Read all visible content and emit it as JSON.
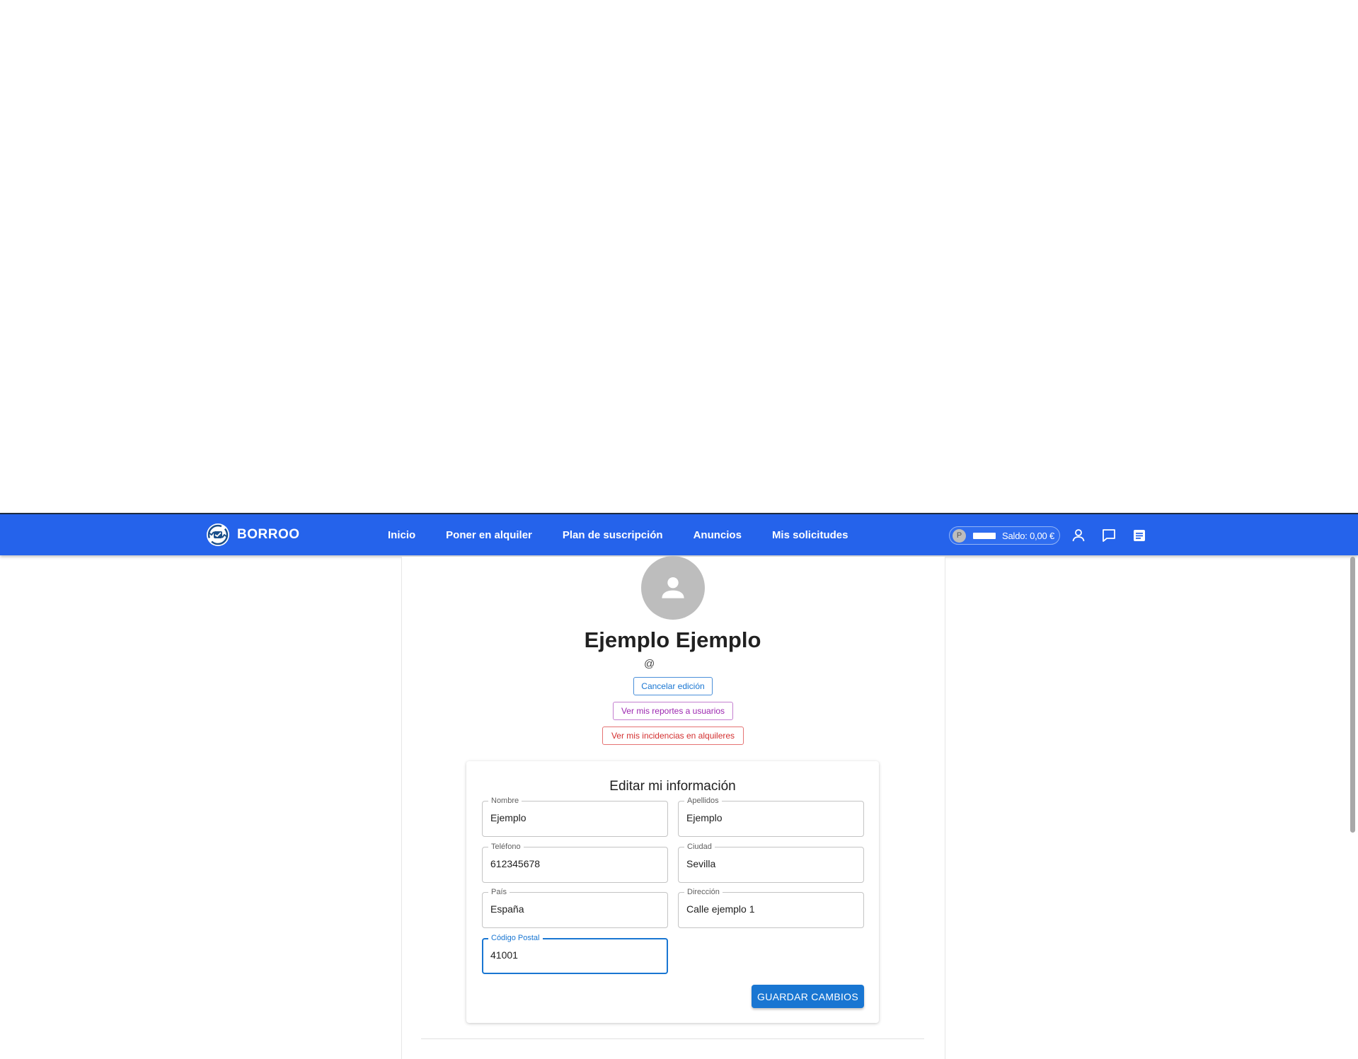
{
  "navbar": {
    "brand": "BORROO",
    "links": [
      "Inicio",
      "Poner en alquiler",
      "Plan de suscripción",
      "Anuncios",
      "Mis solicitudes"
    ],
    "saldo": {
      "avatar_letter": "P",
      "label": "Saldo: 0,00 €"
    },
    "icons": [
      "user-icon",
      "chat-icon",
      "notes-icon"
    ]
  },
  "profile": {
    "name": "Ejemplo Ejemplo",
    "username": "@",
    "cancel_label": "Cancelar edición",
    "reports_label": "Ver mis reportes a usuarios",
    "incidents_label": "Ver mis incidencias en alquileres"
  },
  "form": {
    "title": "Editar mi información",
    "fields": [
      {
        "label": "Nombre",
        "value": "Ejemplo"
      },
      {
        "label": "Apellidos",
        "value": "Ejemplo"
      },
      {
        "label": "Teléfono",
        "value": "612345678"
      },
      {
        "label": "Ciudad",
        "value": "Sevilla"
      },
      {
        "label": "País",
        "value": "España"
      },
      {
        "label": "Dirección",
        "value": "Calle ejemplo 1"
      },
      {
        "label": "Código Postal",
        "value": "41001"
      }
    ],
    "save_label": "GUARDAR CAMBIOS"
  },
  "colors": {
    "navbar": "#2563eb",
    "primary": "#1976d2",
    "secondary": "#9c27b0",
    "error": "#d32f2f"
  }
}
